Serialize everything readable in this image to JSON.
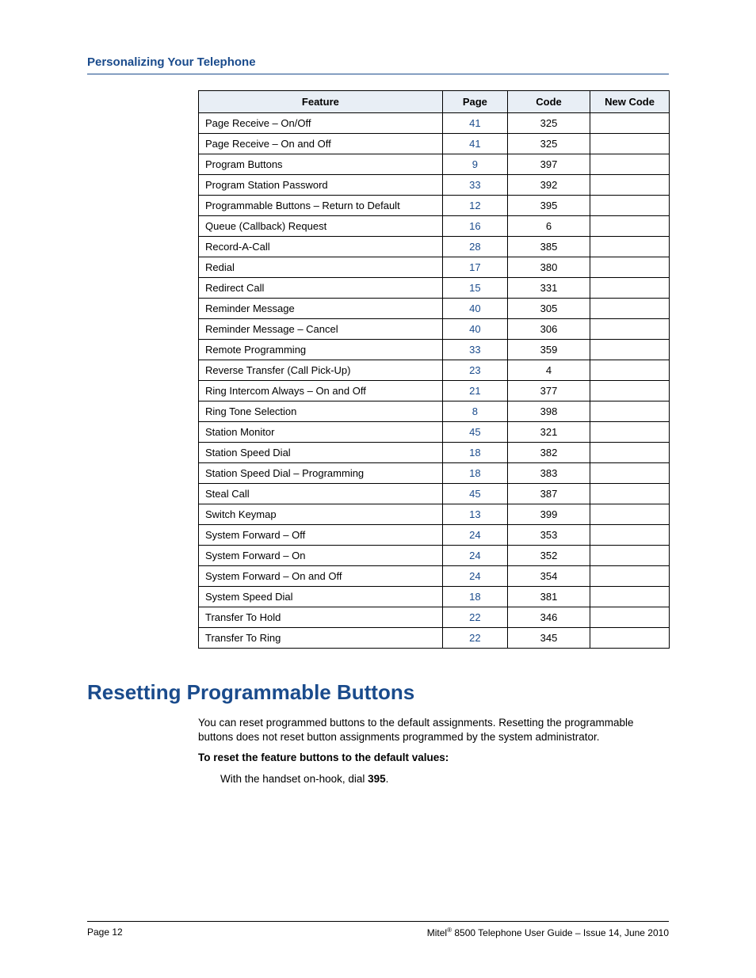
{
  "header": {
    "chapter_title": "Personalizing Your Telephone"
  },
  "table": {
    "columns": {
      "feature": "Feature",
      "page": "Page",
      "code": "Code",
      "newcode": "New Code"
    },
    "rows": [
      {
        "feature": "Page Receive – On/Off",
        "page": "41",
        "code": "325"
      },
      {
        "feature": "Page Receive – On and Off",
        "page": "41",
        "code": "325"
      },
      {
        "feature": "Program Buttons",
        "page": "9",
        "code": "397"
      },
      {
        "feature": "Program Station Password",
        "page": "33",
        "code": "392"
      },
      {
        "feature": "Programmable Buttons – Return to Default",
        "page": "12",
        "code": "395"
      },
      {
        "feature": "Queue (Callback) Request",
        "page": "16",
        "code": "6"
      },
      {
        "feature": "Record-A-Call",
        "page": "28",
        "code": "385"
      },
      {
        "feature": "Redial",
        "page": "17",
        "code": "380"
      },
      {
        "feature": "Redirect Call",
        "page": "15",
        "code": "331"
      },
      {
        "feature": "Reminder Message",
        "page": "40",
        "code": "305"
      },
      {
        "feature": "Reminder Message – Cancel",
        "page": "40",
        "code": "306"
      },
      {
        "feature": "Remote Programming",
        "page": "33",
        "code": "359"
      },
      {
        "feature": "Reverse Transfer (Call Pick-Up)",
        "page": "23",
        "code": "4"
      },
      {
        "feature": "Ring Intercom Always – On and Off",
        "page": "21",
        "code": "377"
      },
      {
        "feature": "Ring Tone Selection",
        "page": "8",
        "code": "398"
      },
      {
        "feature": "Station Monitor",
        "page": "45",
        "code": "321"
      },
      {
        "feature": "Station Speed Dial",
        "page": "18",
        "code": "382"
      },
      {
        "feature": "Station Speed Dial – Programming",
        "page": "18",
        "code": "383"
      },
      {
        "feature": "Steal Call",
        "page": "45",
        "code": "387"
      },
      {
        "feature": "Switch Keymap",
        "page": "13",
        "code": "399"
      },
      {
        "feature": "System Forward – Off",
        "page": "24",
        "code": "353"
      },
      {
        "feature": "System Forward – On",
        "page": "24",
        "code": "352"
      },
      {
        "feature": "System Forward – On and Off",
        "page": "24",
        "code": "354"
      },
      {
        "feature": "System Speed Dial",
        "page": "18",
        "code": "381"
      },
      {
        "feature": "Transfer To Hold",
        "page": "22",
        "code": "346"
      },
      {
        "feature": "Transfer To Ring",
        "page": "22",
        "code": "345"
      }
    ]
  },
  "section": {
    "heading": "Resetting Programmable Buttons",
    "para1": "You can reset programmed buttons to the default assignments. Resetting the programmable buttons does not reset button assignments programmed by the system administrator.",
    "instruction_label": "To reset the feature buttons to the default values:",
    "step_prefix": "With the handset on-hook, dial ",
    "step_code": "395",
    "step_suffix": "."
  },
  "footer": {
    "page_label": "Page 12",
    "brand": "Mitel",
    "doc_title": " 8500 Telephone User Guide – Issue 14, June 2010"
  }
}
